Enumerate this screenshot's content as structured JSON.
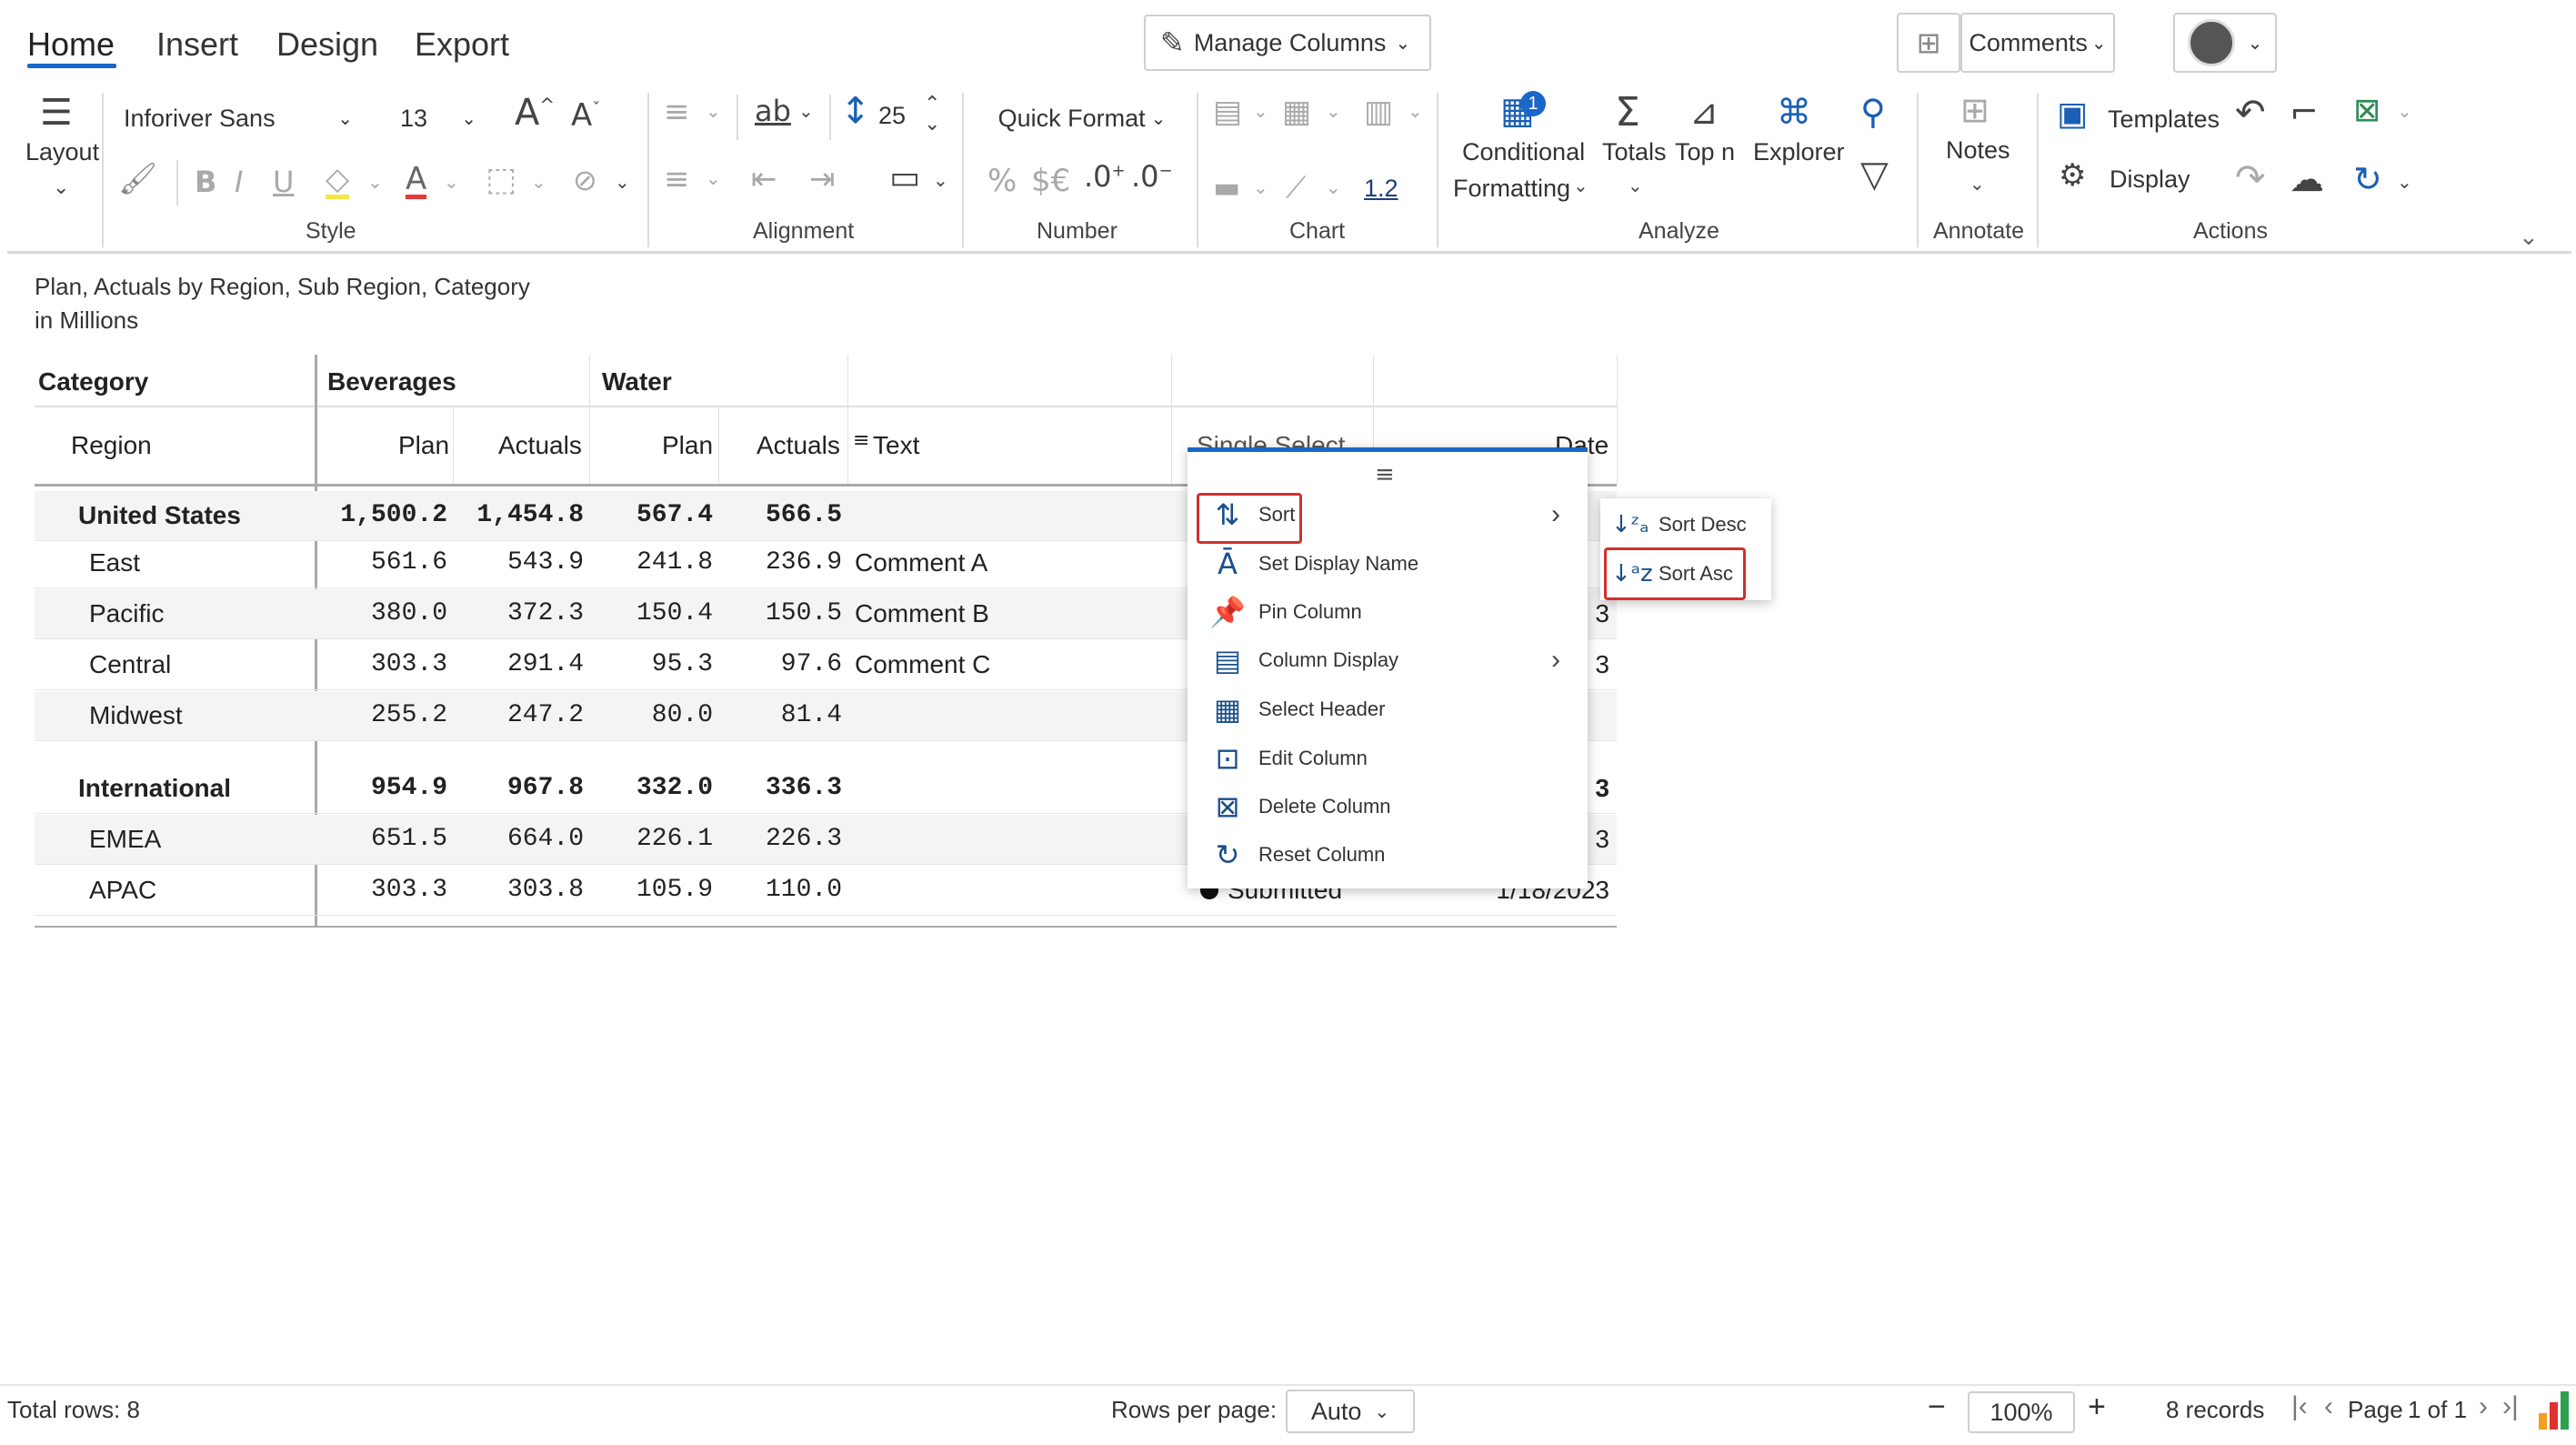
{
  "ribbon": {
    "tabs": [
      "Home",
      "Insert",
      "Design",
      "Export"
    ],
    "manage_columns": "Manage Columns",
    "comments": "Comments",
    "layout_label": "Layout",
    "font_name": "Inforiver Sans",
    "font_size": "13",
    "row_height": "25",
    "quick_format": "Quick Format",
    "decimal_sample": "1.2",
    "conditional_formatting": [
      "Conditional",
      "Formatting"
    ],
    "cf_badge": "1",
    "totals": "Totals",
    "top_n": "Top n",
    "explorer": "Explorer",
    "notes": "Notes",
    "templates": "Templates",
    "display": "Display",
    "groups": [
      "Style",
      "Alignment",
      "Number",
      "Chart",
      "Analyze",
      "Annotate",
      "Actions"
    ]
  },
  "report": {
    "title": "Plan, Actuals by Region, Sub Region, Category",
    "subtitle": "in Millions",
    "header_category": "Category",
    "header_region": "Region",
    "col_group_1": "Beverages",
    "col_group_2": "Water",
    "plan": "Plan",
    "actuals": "Actuals",
    "text_col": "Text",
    "single_select_col": "Single Select",
    "date_col": "Date",
    "rows": [
      {
        "name": "United States",
        "bold": true,
        "b_plan": "1,500.2",
        "b_act": "1,454.8",
        "w_plan": "567.4",
        "w_act": "566.5",
        "text": "",
        "select": "",
        "date": ""
      },
      {
        "name": "East",
        "bold": false,
        "b_plan": "561.6",
        "b_act": "543.9",
        "w_plan": "241.8",
        "w_act": "236.9",
        "text": "Comment A",
        "select": "",
        "date": ""
      },
      {
        "name": "Pacific",
        "bold": false,
        "b_plan": "380.0",
        "b_act": "372.3",
        "w_plan": "150.4",
        "w_act": "150.5",
        "text": "Comment B",
        "select": "",
        "date": "3"
      },
      {
        "name": "Central",
        "bold": false,
        "b_plan": "303.3",
        "b_act": "291.4",
        "w_plan": "95.3",
        "w_act": "97.6",
        "text": "Comment C",
        "select": "",
        "date": "3"
      },
      {
        "name": "Midwest",
        "bold": false,
        "b_plan": "255.2",
        "b_act": "247.2",
        "w_plan": "80.0",
        "w_act": "81.4",
        "text": "",
        "select": "",
        "date": ""
      },
      {
        "name": "International",
        "bold": true,
        "b_plan": "954.9",
        "b_act": "967.8",
        "w_plan": "332.0",
        "w_act": "336.3",
        "text": "",
        "select": "",
        "date": "3"
      },
      {
        "name": "EMEA",
        "bold": false,
        "b_plan": "651.5",
        "b_act": "664.0",
        "w_plan": "226.1",
        "w_act": "226.3",
        "text": "",
        "select": "",
        "date": "3"
      },
      {
        "name": "APAC",
        "bold": false,
        "b_plan": "303.3",
        "b_act": "303.8",
        "w_plan": "105.9",
        "w_act": "110.0",
        "text": "",
        "select": "Submitted",
        "date": "1/18/2023"
      }
    ]
  },
  "context_menu": {
    "items": [
      "Sort",
      "Set Display Name",
      "Pin Column",
      "Column Display",
      "Select Header",
      "Edit Column",
      "Delete Column",
      "Reset Column"
    ],
    "submenu": [
      "Sort Desc",
      "Sort Asc"
    ]
  },
  "footer": {
    "total_rows": "Total rows: 8",
    "rows_per_page_label": "Rows per page:",
    "rows_per_page_value": "Auto",
    "zoom": "100%",
    "records": "8 records",
    "page_label": "Page",
    "page_info": "1 of 1"
  },
  "colors": {
    "accent": "#1a66c9",
    "highlight": "#d32f2f"
  }
}
